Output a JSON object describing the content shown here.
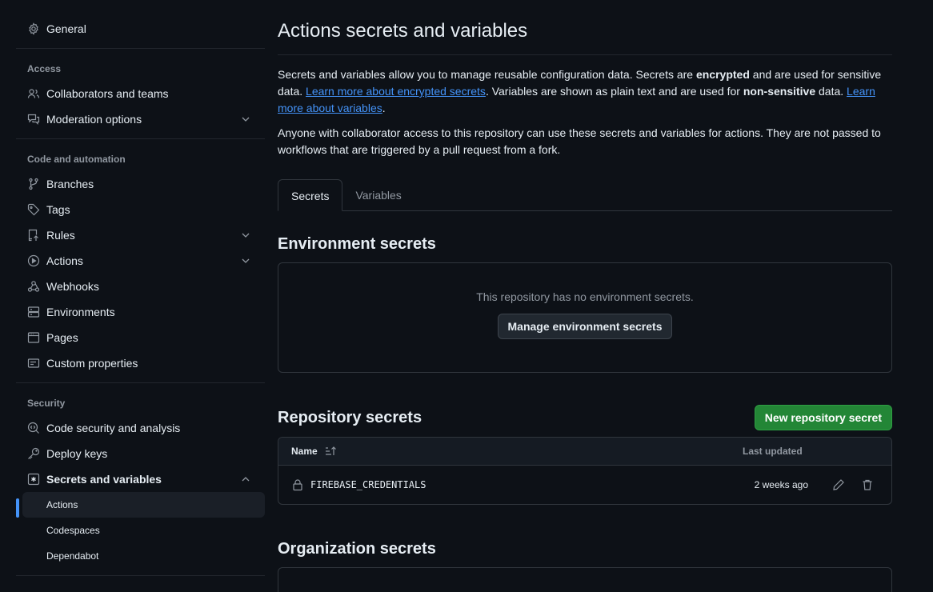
{
  "sidebar": {
    "general": "General",
    "groups": [
      {
        "title": "Access",
        "items": [
          {
            "label": "Collaborators and teams",
            "icon": "people-icon",
            "expandable": false
          },
          {
            "label": "Moderation options",
            "icon": "comment-discussion-icon",
            "expandable": true
          }
        ]
      },
      {
        "title": "Code and automation",
        "items": [
          {
            "label": "Branches",
            "icon": "git-branch-icon",
            "expandable": false
          },
          {
            "label": "Tags",
            "icon": "tag-icon",
            "expandable": false
          },
          {
            "label": "Rules",
            "icon": "repo-push-icon",
            "expandable": true
          },
          {
            "label": "Actions",
            "icon": "play-icon",
            "expandable": true
          },
          {
            "label": "Webhooks",
            "icon": "webhook-icon",
            "expandable": false
          },
          {
            "label": "Environments",
            "icon": "server-icon",
            "expandable": false
          },
          {
            "label": "Pages",
            "icon": "browser-icon",
            "expandable": false
          },
          {
            "label": "Custom properties",
            "icon": "note-icon",
            "expandable": false
          }
        ]
      },
      {
        "title": "Security",
        "items": [
          {
            "label": "Code security and analysis",
            "icon": "codescan-icon",
            "expandable": false
          },
          {
            "label": "Deploy keys",
            "icon": "key-icon",
            "expandable": false
          },
          {
            "label": "Secrets and variables",
            "icon": "key-asterisk-icon",
            "expandable": true,
            "expanded": true
          }
        ]
      }
    ],
    "sub_items": [
      {
        "label": "Actions",
        "active": true
      },
      {
        "label": "Codespaces",
        "active": false
      },
      {
        "label": "Dependabot",
        "active": false
      }
    ]
  },
  "main": {
    "title": "Actions secrets and variables",
    "desc1": {
      "part1": "Secrets and variables allow you to manage reusable configuration data. Secrets are ",
      "bold1": "encrypted",
      "part2": " and are used for sensitive data. ",
      "link1": "Learn more about encrypted secrets",
      "part3": ". Variables are shown as plain text and are used for ",
      "bold2": "non-sensitive",
      "part4": " data. ",
      "link2": "Learn more about variables",
      "part5": "."
    },
    "desc2": "Anyone with collaborator access to this repository can use these secrets and variables for actions. They are not passed to workflows that are triggered by a pull request from a fork.",
    "tabs": [
      {
        "label": "Secrets",
        "active": true
      },
      {
        "label": "Variables",
        "active": false
      }
    ],
    "environment": {
      "title": "Environment secrets",
      "empty_text": "This repository has no environment secrets.",
      "button": "Manage environment secrets"
    },
    "repository": {
      "title": "Repository secrets",
      "new_button": "New repository secret",
      "columns": {
        "name": "Name",
        "updated": "Last updated"
      },
      "rows": [
        {
          "name": "FIREBASE_CREDENTIALS",
          "updated": "2 weeks ago"
        }
      ]
    },
    "organization": {
      "title": "Organization secrets"
    }
  },
  "colors": {
    "background": "#0d1117",
    "accent": "#4493f8",
    "primary_button": "#238636",
    "muted_text": "#9198a1"
  }
}
